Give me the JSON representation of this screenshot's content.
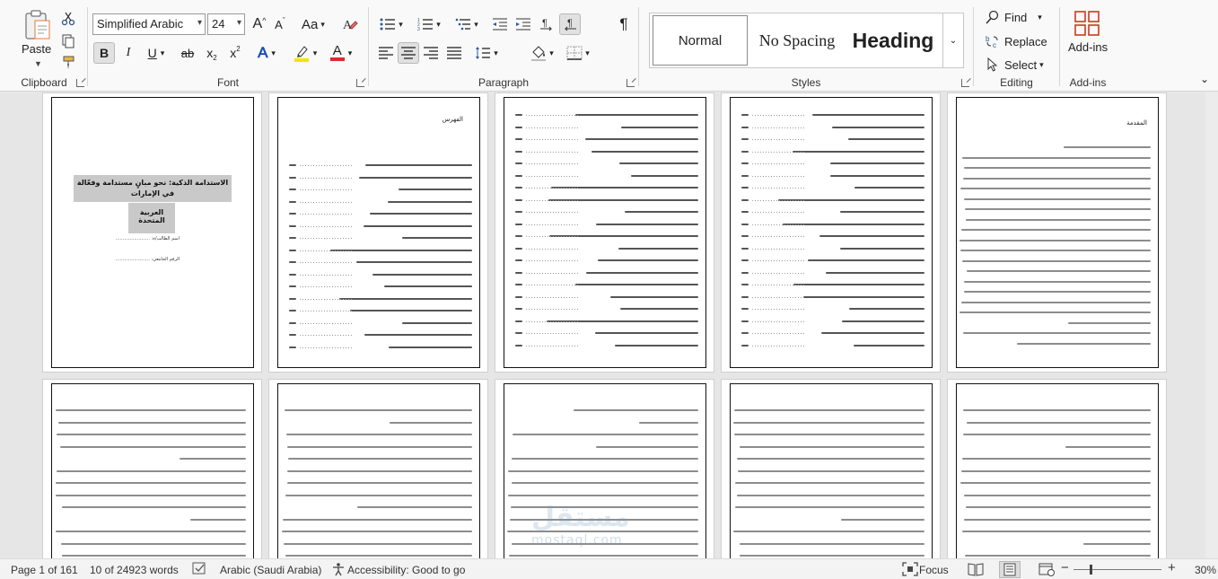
{
  "ribbon": {
    "clipboard": {
      "label": "Clipboard",
      "paste": "Paste"
    },
    "font": {
      "label": "Font",
      "family": "Simplified Arabic",
      "size": "24",
      "grow": "A",
      "shrink": "A",
      "case": "Aa",
      "bold": "B",
      "italic": "I",
      "underline": "U",
      "strike": "ab",
      "subscript": "x",
      "superscript": "x",
      "effects": "A",
      "font_color": "A"
    },
    "paragraph": {
      "label": "Paragraph",
      "pilcrow": "¶"
    },
    "styles": {
      "label": "Styles",
      "items": [
        "Normal",
        "No Spacing",
        "Heading"
      ]
    },
    "editing": {
      "label": "Editing",
      "find": "Find",
      "replace": "Replace",
      "select": "Select"
    },
    "addins": {
      "button": "Add-ins",
      "label": "Add-ins"
    }
  },
  "pages": {
    "cover_title": "الاستدامة الذكية: نحو مبانٍ مستدامة وفعّالة في الإمارات",
    "cover_subtitle": "العربية المتحدة",
    "cover_student": "اسم الطالب/ة: ........................",
    "cover_supervisor": "الرقم الجامعي: ........................",
    "toc_title": "الفهرس",
    "intro_title": "المقدمة"
  },
  "watermark": {
    "logo": "مستقل",
    "text": "mostaql.com"
  },
  "status": {
    "page": "Page 1 of 161",
    "words": "10 of 24923 words",
    "language": "Arabic (Saudi Arabia)",
    "accessibility": "Accessibility: Good to go",
    "focus": "Focus",
    "zoom": "30%"
  },
  "colors": {
    "ribbon_bg": "#f9f9f9",
    "doc_bg": "#e6e6e6",
    "highlight": "#f2e600",
    "font_color": "#d32f2f",
    "accent_blue": "#2b5797"
  }
}
